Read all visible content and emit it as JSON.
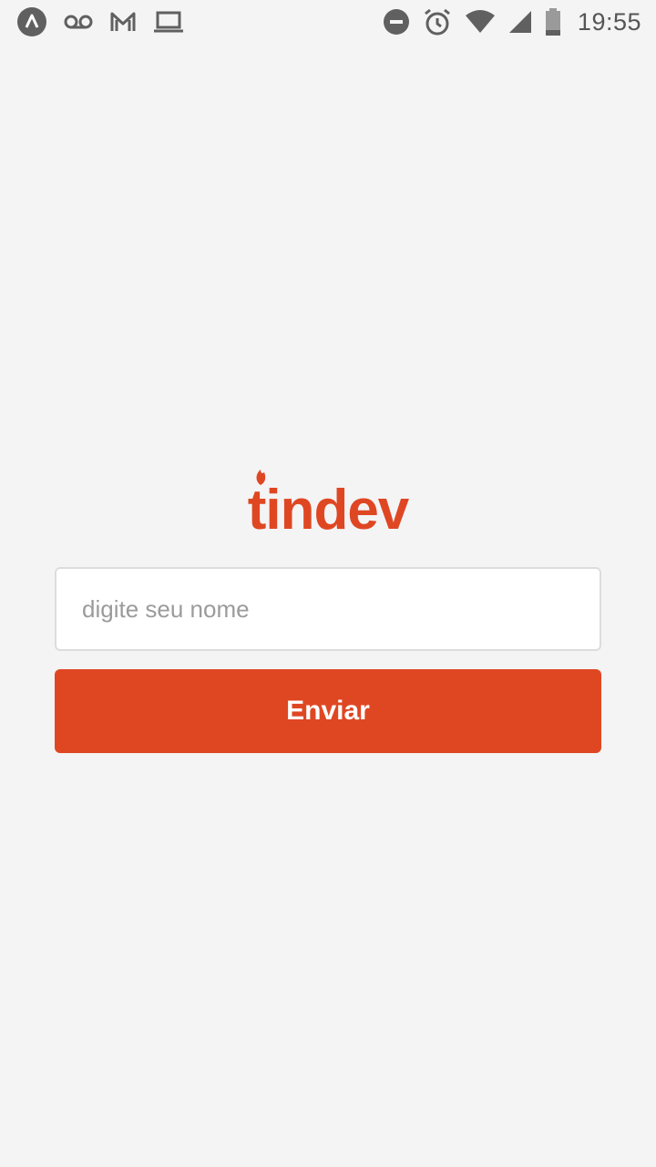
{
  "status_bar": {
    "time": "19:55",
    "left_icons": [
      "expo-icon",
      "voicemail-icon",
      "gmail-icon",
      "laptop-icon"
    ],
    "right_icons": [
      "do-not-disturb-icon",
      "alarm-icon",
      "wifi-icon",
      "signal-icon",
      "battery-icon"
    ]
  },
  "logo": {
    "text": "tindev",
    "color": "#df4723"
  },
  "login": {
    "input_placeholder": "digite seu nome",
    "input_value": "",
    "submit_label": "Enviar"
  },
  "colors": {
    "accent": "#df4723",
    "background": "#f4f4f4",
    "input_border": "#dddddd"
  }
}
